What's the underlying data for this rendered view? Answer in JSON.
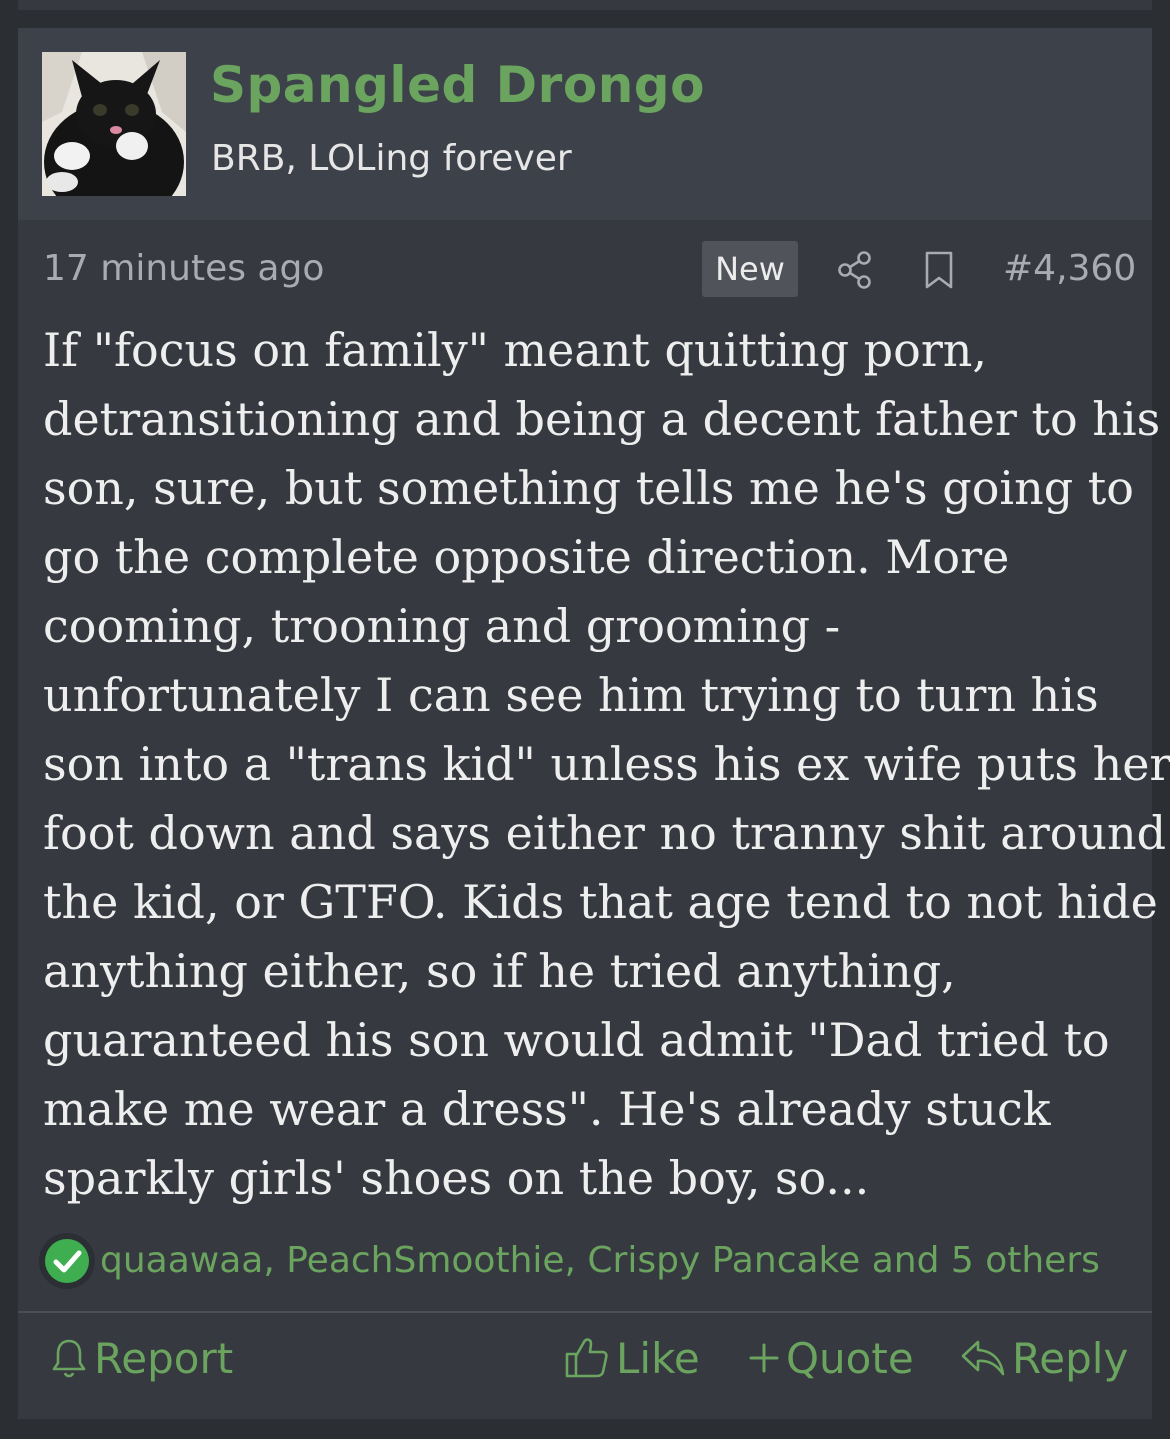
{
  "post": {
    "author": "Spangled Drongo",
    "user_title": "BRB, LOLing forever",
    "time": "17 minutes ago",
    "badge": "New",
    "number": "#4,360",
    "body_lines": [
      "If \"focus on family\" meant quitting porn,",
      "detransitioning and being a decent father to his",
      "son, sure, but something tells me he's going to",
      "go the complete opposite direction. More",
      "cooming, trooning and grooming -",
      "unfortunately I can see him trying to turn his",
      "son into a \"trans kid\" unless his ex wife puts her",
      "foot down and says either no tranny shit around",
      "the kid, or GTFO. Kids that age tend to not hide",
      "anything either, so if he tried anything,",
      "guaranteed his son would admit \"Dad tried to",
      "make me wear a dress\". He's already stuck",
      "sparkly girls' shoes on the boy, so..."
    ],
    "reactions_text": "quaawaa, PeachSmoothie, Crispy Pancake and 5 others"
  },
  "actions": {
    "report": "Report",
    "like": "Like",
    "quote": "Quote",
    "reply": "Reply"
  },
  "icons": {
    "share": "share-icon",
    "bookmark": "bookmark-icon",
    "reaction": "check-reaction-icon",
    "report": "bell-icon",
    "like": "thumbs-up-icon",
    "quote": "plus-icon",
    "reply": "reply-arrow-icon"
  },
  "colors": {
    "accent": "#6aa45e",
    "reaction_badge": "#3fae51",
    "background": "#363940",
    "header": "#3d414a"
  }
}
